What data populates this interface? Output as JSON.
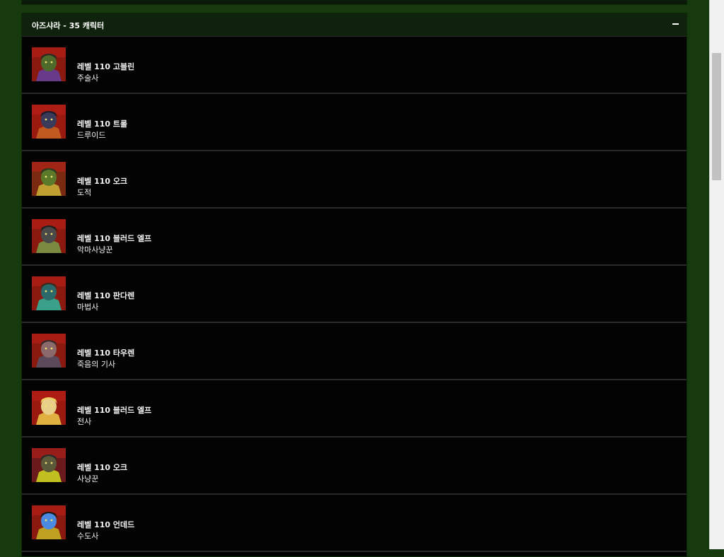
{
  "section": {
    "title": "아즈샤라 - 35 캐릭터",
    "collapse_icon": "minus-icon"
  },
  "characters": [
    {
      "level_race": "레벨 110 고블린",
      "class": "주술사",
      "portrait": {
        "bg": "#8a1a10",
        "face": "#4e6a2a",
        "accent": "#6a3a8a",
        "hair": "#2a2a20"
      }
    },
    {
      "level_race": "레벨 110 트롤",
      "class": "드루이드",
      "portrait": {
        "bg": "#9a1a10",
        "face": "#3a3a5a",
        "accent": "#c05a20",
        "hair": "#1a1a2a"
      }
    },
    {
      "level_race": "레벨 110 오크",
      "class": "도적",
      "portrait": {
        "bg": "#7a2a10",
        "face": "#5a7a2a",
        "accent": "#c0a030",
        "hair": "#2a3a20"
      }
    },
    {
      "level_race": "레벨 110 블러드 엘프",
      "class": "악마사냥꾼",
      "portrait": {
        "bg": "#8a1a10",
        "face": "#4a4a4a",
        "accent": "#7a8a40",
        "hair": "#202020"
      }
    },
    {
      "level_race": "레벨 110 판다렌",
      "class": "마법사",
      "portrait": {
        "bg": "#8a1a10",
        "face": "#2a6a6a",
        "accent": "#3aa08a",
        "hair": "#3a2a1a"
      }
    },
    {
      "level_race": "레벨 110 타우렌",
      "class": "죽음의 기사",
      "portrait": {
        "bg": "#8a1a10",
        "face": "#8a6a6a",
        "accent": "#5a4a5a",
        "hair": "#3a2a2a"
      }
    },
    {
      "level_race": "레벨 110 블러드 엘프",
      "class": "전사",
      "portrait": {
        "bg": "#9a1a10",
        "face": "#e8d08a",
        "accent": "#e0b040",
        "hair": "#f0d060"
      }
    },
    {
      "level_race": "레벨 110 오크",
      "class": "사냥꾼",
      "portrait": {
        "bg": "#6a1a1a",
        "face": "#5a5a3a",
        "accent": "#c0c020",
        "hair": "#2a2a2a"
      }
    },
    {
      "level_race": "레벨 110 언데드",
      "class": "수도사",
      "portrait": {
        "bg": "#8a1a10",
        "face": "#4a8ae0",
        "accent": "#c0a020",
        "hair": "#1a1a1a"
      }
    }
  ]
}
